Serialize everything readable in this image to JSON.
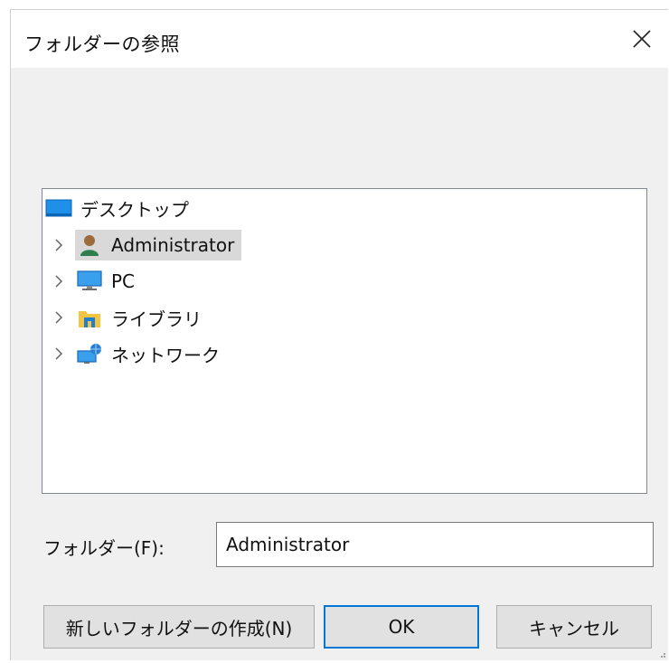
{
  "dialog": {
    "title": "フォルダーの参照",
    "close_icon": "close-icon"
  },
  "tree": {
    "root": {
      "label": "デスクトップ",
      "icon": "desktop-icon"
    },
    "items": [
      {
        "label": "Administrator",
        "icon": "user-icon",
        "selected": true
      },
      {
        "label": "PC",
        "icon": "computer-icon",
        "selected": false
      },
      {
        "label": "ライブラリ",
        "icon": "library-icon",
        "selected": false
      },
      {
        "label": "ネットワーク",
        "icon": "network-icon",
        "selected": false
      }
    ]
  },
  "folder_field": {
    "label": "フォルダー(F):",
    "value": "Administrator"
  },
  "buttons": {
    "new_folder": "新しいフォルダーの作成(N)",
    "ok": "OK",
    "cancel": "キャンセル"
  },
  "colors": {
    "accent": "#0078d7",
    "dialog_bg": "#f0f0f0",
    "selection_bg": "#d9d9d9"
  }
}
